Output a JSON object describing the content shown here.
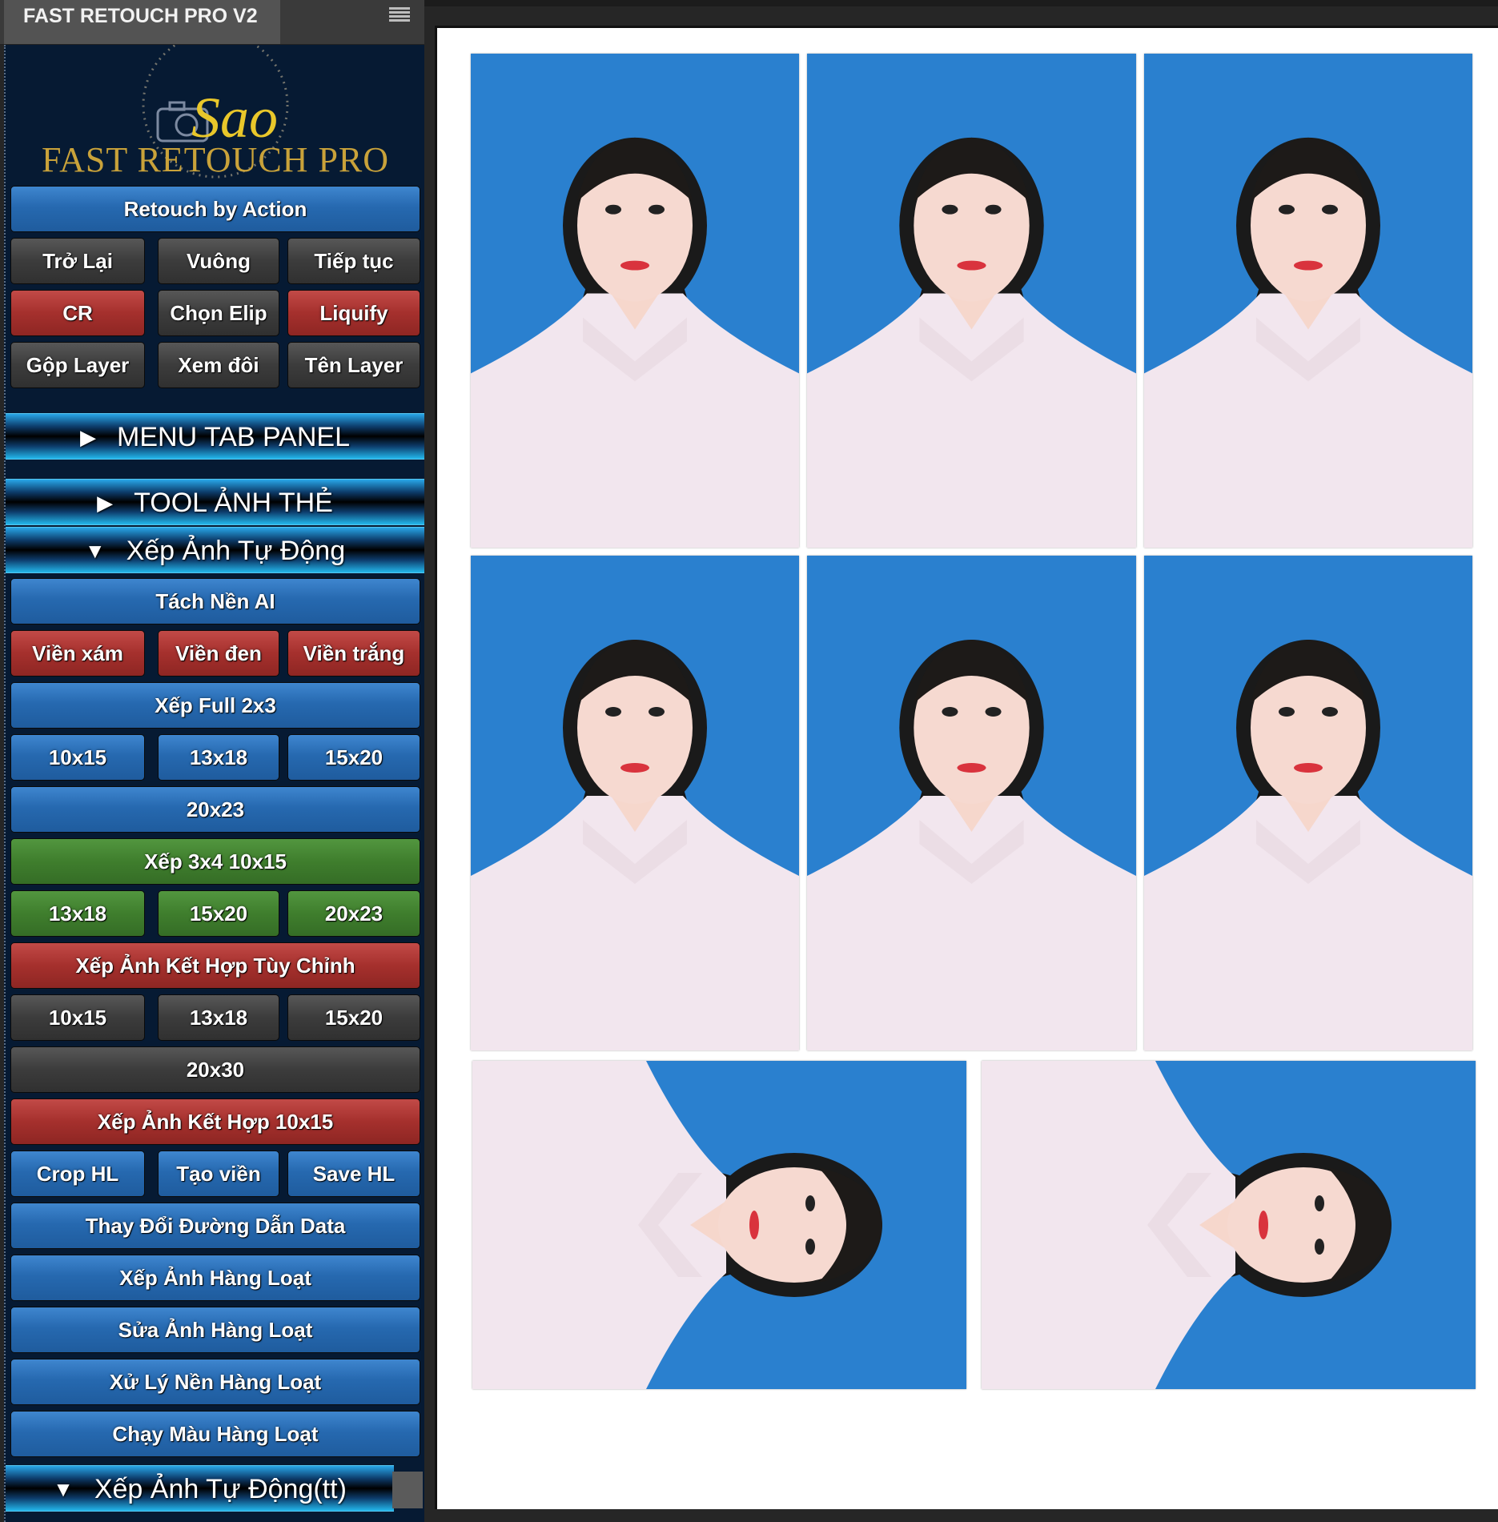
{
  "panel": {
    "title": "FAST RETOUCH PRO V2",
    "menu_icon": "hamburger-menu-icon",
    "logo": {
      "script_text": "Sao",
      "brand_text": "FAST RETOUCH PRO",
      "icon": "camera-icon"
    },
    "retouch_by_action": "Retouch by Action",
    "action_rows": [
      [
        {
          "label": "Trở Lại",
          "color": "gray"
        },
        {
          "label": "Vuông",
          "color": "gray"
        },
        {
          "label": "Tiếp tục",
          "color": "gray"
        }
      ],
      [
        {
          "label": "CR",
          "color": "red"
        },
        {
          "label": "Chọn Elip",
          "color": "gray"
        },
        {
          "label": "Liquify",
          "color": "red"
        }
      ],
      [
        {
          "label": "Gộp Layer",
          "color": "gray"
        },
        {
          "label": "Xem đôi",
          "color": "gray"
        },
        {
          "label": "Tên Layer",
          "color": "gray"
        }
      ]
    ],
    "sections": {
      "menu_tab_panel": {
        "label": "MENU TAB PANEL",
        "state": "collapsed"
      },
      "tool_anh_the": {
        "label": "TOOL ẢNH THẺ",
        "state": "collapsed"
      },
      "xep_anh_tu_dong": {
        "label": "Xếp Ảnh Tự Động",
        "state": "expanded"
      },
      "xep_anh_tu_dong_tt": {
        "label": "Xếp Ảnh Tự Động(tt)",
        "state": "expanded"
      }
    },
    "auto_buttons": {
      "tach_nen_ai": "Tách Nền AI",
      "vien": [
        "Viền xám",
        "Viền đen",
        "Viền trắng"
      ],
      "xep_full": "Xếp Full 2x3",
      "full_sizes": [
        "10x15",
        "13x18",
        "15x20"
      ],
      "full_size_wide": "20x23",
      "xep_3x4": "Xếp 3x4 10x15",
      "sizes_3x4": [
        "13x18",
        "15x20",
        "20x23"
      ],
      "ket_hop_tuy_chinh": "Xếp Ảnh Kết Hợp Tùy Chỉnh",
      "tuy_chinh_sizes": [
        "10x15",
        "13x18",
        "15x20"
      ],
      "tuy_chinh_wide": "20x30",
      "ket_hop_10x15": "Xếp Ảnh Kết Hợp 10x15",
      "hl_tools": [
        "Crop HL",
        "Tạo viền",
        "Save HL"
      ],
      "thay_doi_duong_dan": "Thay Đổi Đường Dẫn Data",
      "xep_hang_loat": "Xếp Ảnh Hàng Loạt",
      "sua_hang_loat": "Sửa Ảnh Hàng Loạt",
      "xu_ly_nen": "Xử Lý Nền Hàng Loạt",
      "chay_mau": "Chạy Màu Hàng Loạt"
    }
  },
  "document": {
    "layout": "2 rows × 3 portrait ID photos + 1 row × 2 rotated photos",
    "photo_background": "#2a80cf",
    "photos": [
      {
        "orientation": "portrait"
      },
      {
        "orientation": "portrait"
      },
      {
        "orientation": "portrait"
      },
      {
        "orientation": "portrait"
      },
      {
        "orientation": "portrait"
      },
      {
        "orientation": "portrait"
      },
      {
        "orientation": "rotated-90"
      },
      {
        "orientation": "rotated-90"
      }
    ]
  },
  "colors": {
    "panel_bg": "#061a33",
    "blue": "#2669b0",
    "red": "#a5302d",
    "green": "#3f7e2d",
    "gray": "#3c3c3c",
    "logo_gold": "#c9a23a"
  }
}
